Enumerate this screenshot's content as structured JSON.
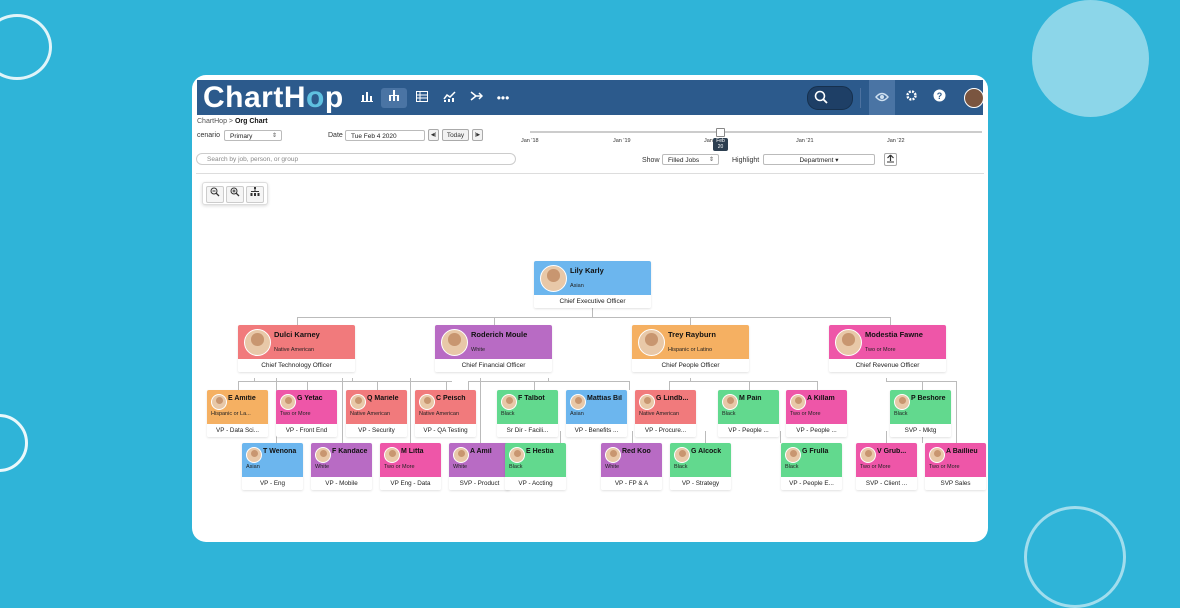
{
  "colors": {
    "blue": "#6cb6ee",
    "red": "#f17a7c",
    "purple": "#b86bc4",
    "orange": "#f5b062",
    "pink": "#ee56a8",
    "green": "#62d98e",
    "topbar": "#2c5a8c"
  },
  "app": {
    "logo_pre": "ChartH",
    "logo_o": "o",
    "logo_post": "p"
  },
  "toolbar": {
    "icons": [
      "bar-chart-icon",
      "org-chart-icon",
      "table-icon",
      "trend-icon",
      "merge-icon",
      "more-icon"
    ],
    "right_icons": [
      "eye-icon",
      "gear-icon",
      "help-icon"
    ]
  },
  "breadcrumb": {
    "root": "ChartHop",
    "sep": ">",
    "current": "Org Chart"
  },
  "controls": {
    "scenario_label": "cenario",
    "scenario_value": "Primary",
    "date_label": "Date",
    "date_value": "Tue Feb 4 2020",
    "prev": "◀|",
    "today": "Today",
    "next": "|▶",
    "show_label": "Show",
    "show_value": "Filled Jobs",
    "highlight_label": "Highlight",
    "highlight_value": "Department",
    "search_placeholder": "Search by job, person, or group"
  },
  "timeline": {
    "labels": [
      "Jan '18",
      "Jan '19",
      "Jan '20",
      "Jan '21",
      "Jan '22"
    ],
    "badge_top": "Feb",
    "badge_bottom": "20"
  },
  "org": {
    "ceo": {
      "name": "Lily Karly",
      "eth": "Asian",
      "title": "Chief Executive Officer",
      "color": "blue"
    },
    "execs": [
      {
        "name": "Dulci Karney",
        "eth": "Native American",
        "title": "Chief Technology Officer",
        "color": "red"
      },
      {
        "name": "Roderich Moule",
        "eth": "White",
        "title": "Chief Financial Officer",
        "color": "purple"
      },
      {
        "name": "Trey Rayburn",
        "eth": "Hispanic or Latino",
        "title": "Chief People Officer",
        "color": "orange"
      },
      {
        "name": "Modestia Fawne",
        "eth": "Two or More",
        "title": "Chief Revenue Officer",
        "color": "pink"
      }
    ],
    "row1": [
      {
        "name": "E Amitie",
        "eth": "Hispanic or La...",
        "title": "VP - Data Sci...",
        "color": "orange"
      },
      {
        "name": "G Yetac",
        "eth": "Two or More",
        "title": "VP - Front End",
        "color": "pink"
      },
      {
        "name": "Q Mariele",
        "eth": "Native American",
        "title": "VP - Security",
        "color": "red"
      },
      {
        "name": "C Peisch",
        "eth": "Native American",
        "title": "VP - QA Testing",
        "color": "red"
      },
      {
        "name": "F Talbot",
        "eth": "Black",
        "title": "Sr Dir - Facili...",
        "color": "green"
      },
      {
        "name": "Mattias Bil",
        "eth": "Asian",
        "title": "VP - Benefits ...",
        "color": "blue"
      },
      {
        "name": "G Lindb...",
        "eth": "Native American",
        "title": "VP - Procure...",
        "color": "red"
      },
      {
        "name": "M Pain",
        "eth": "Black",
        "title": "VP - People ...",
        "color": "green"
      },
      {
        "name": "A Killam",
        "eth": "Two or More",
        "title": "VP - People ...",
        "color": "pink"
      },
      {
        "name": "P Beshore",
        "eth": "Black",
        "title": "SVP - Mktg",
        "color": "green"
      }
    ],
    "row2": [
      {
        "name": "T Wenona",
        "eth": "Asian",
        "title": "VP - Eng",
        "color": "blue"
      },
      {
        "name": "F Kandace",
        "eth": "White",
        "title": "VP - Mobile",
        "color": "purple"
      },
      {
        "name": "M Litta",
        "eth": "Two or More",
        "title": "VP Eng - Data",
        "color": "pink"
      },
      {
        "name": "A Amil",
        "eth": "White",
        "title": "SVP - Product",
        "color": "purple"
      },
      {
        "name": "E Hestia",
        "eth": "Black",
        "title": "VP - Accting",
        "color": "green"
      },
      {
        "name": "Red Koo",
        "eth": "White",
        "title": "VP - FP & A",
        "color": "purple"
      },
      {
        "name": "G Alcock",
        "eth": "Black",
        "title": "VP - Strategy",
        "color": "green"
      },
      {
        "name": "G Frulla",
        "eth": "Black",
        "title": "VP - People E...",
        "color": "green"
      },
      {
        "name": "V Grub...",
        "eth": "Two or More",
        "title": "SVP - Client ...",
        "color": "pink"
      },
      {
        "name": "A Baillieu",
        "eth": "Two or More",
        "title": "SVP Sales",
        "color": "pink"
      }
    ]
  }
}
